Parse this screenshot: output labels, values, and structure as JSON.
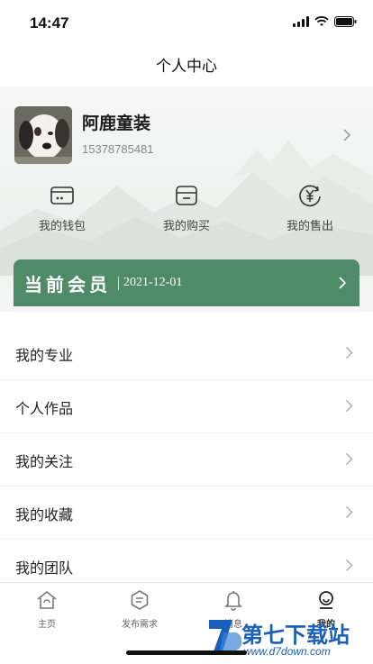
{
  "status_bar": {
    "time": "14:47"
  },
  "nav": {
    "title": "个人中心"
  },
  "profile": {
    "name": "阿鹿童装",
    "phone": "15378785481"
  },
  "quick_actions": [
    {
      "label": "我的钱包",
      "icon": "wallet-icon"
    },
    {
      "label": "我的购买",
      "icon": "purchase-box-icon"
    },
    {
      "label": "我的售出",
      "icon": "yen-coin-icon"
    }
  ],
  "membership": {
    "title": "当前会员",
    "date": "2021-12-01"
  },
  "menu": [
    {
      "label": "我的专业"
    },
    {
      "label": "个人作品"
    },
    {
      "label": "我的关注"
    },
    {
      "label": "我的收藏"
    },
    {
      "label": "我的团队"
    }
  ],
  "tabs": [
    {
      "label": "主页",
      "icon": "home-icon"
    },
    {
      "label": "发布需求",
      "icon": "publish-icon"
    },
    {
      "label": "消息",
      "icon": "bell-icon"
    },
    {
      "label": "我的",
      "icon": "profile-icon"
    }
  ],
  "watermark": {
    "text": "第七下载站",
    "url": "www.d7down.com"
  },
  "colors": {
    "accent_green": "#4f8a69",
    "background": "#ffffff"
  }
}
